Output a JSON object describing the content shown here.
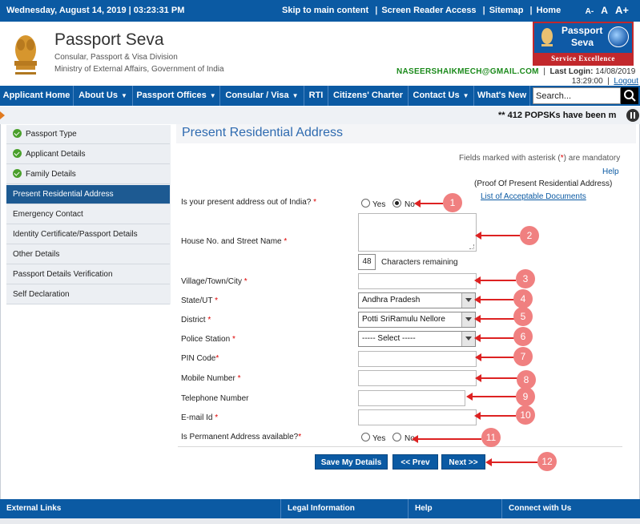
{
  "topbar": {
    "datetime": "Wednesday,  August  14, 2019 | 03:23:31 PM",
    "skip": "Skip to main content",
    "reader": "Screen Reader Access",
    "sitemap": "Sitemap",
    "home": "Home",
    "font_small": "A-",
    "font_normal": "A",
    "font_large": "A+"
  },
  "header": {
    "title": "Passport Seva",
    "subtitle1": "Consular, Passport & Visa Division",
    "subtitle2": "Ministry of External Affairs, Government of India",
    "logo_line1": "Passport",
    "logo_line2": "Seva",
    "logo_band": "Service Excellence",
    "email": "NASEERSHAIKMECH@GMAIL.COM",
    "last_login_label": "Last Login:",
    "last_login_date": "14/08/2019",
    "last_login_time": "13:29:00",
    "logout": "Logout"
  },
  "nav": {
    "items": [
      "Applicant Home",
      "About Us",
      "Passport Offices",
      "Consular / Visa",
      "RTI",
      "Citizens' Charter",
      "Contact Us",
      "What's New"
    ],
    "search_value": "Search..."
  },
  "ticker": {
    "text": "** 412 POPSKs have been m"
  },
  "sidebar": {
    "items": [
      "Passport Type",
      "Applicant Details",
      "Family Details",
      "Present Residential Address",
      "Emergency Contact",
      "Identity Certificate/Passport Details",
      "Other Details",
      "Passport Details Verification",
      "Self Declaration"
    ]
  },
  "form": {
    "title": "Present Residential Address",
    "mandatory_pre": "Fields marked with asterisk (",
    "mandatory_ast": "*",
    "mandatory_post": ") are mandatory",
    "help": "Help",
    "proof": "(Proof Of Present Residential Address)",
    "docs_link": "List of Acceptable Documents",
    "q_out_of_india": "Is your present address out of India?",
    "yes": "Yes",
    "no": "No",
    "house_label": "House No. and Street Name",
    "chars_count": "48",
    "chars_label": "Characters remaining",
    "village_label": "Village/Town/City",
    "state_label": "State/UT",
    "state_value": "Andhra Pradesh",
    "district_label": "District",
    "district_value": "Potti SriRamulu Nellore",
    "police_label": "Police Station",
    "police_value": "----- Select -----",
    "pin_label": "PIN Code",
    "mobile_label": "Mobile Number",
    "telephone_label": "Telephone Number",
    "email_label": "E-mail Id",
    "permanent_label": "Is Permanent Address available?",
    "asterisk": "*",
    "save": "Save My Details",
    "prev": "<< Prev",
    "next": "Next >>"
  },
  "annotations": [
    "1",
    "2",
    "3",
    "4",
    "5",
    "6",
    "7",
    "8",
    "9",
    "10",
    "11",
    "12"
  ],
  "footer": {
    "cols": [
      "External Links",
      "Legal Information",
      "Help",
      "Connect with Us"
    ]
  },
  "colors": {
    "brand_blue": "#0b5aa3",
    "annotation_red": "#d22",
    "badge_pink": "#f08080",
    "email_green": "#1b8a1b"
  }
}
